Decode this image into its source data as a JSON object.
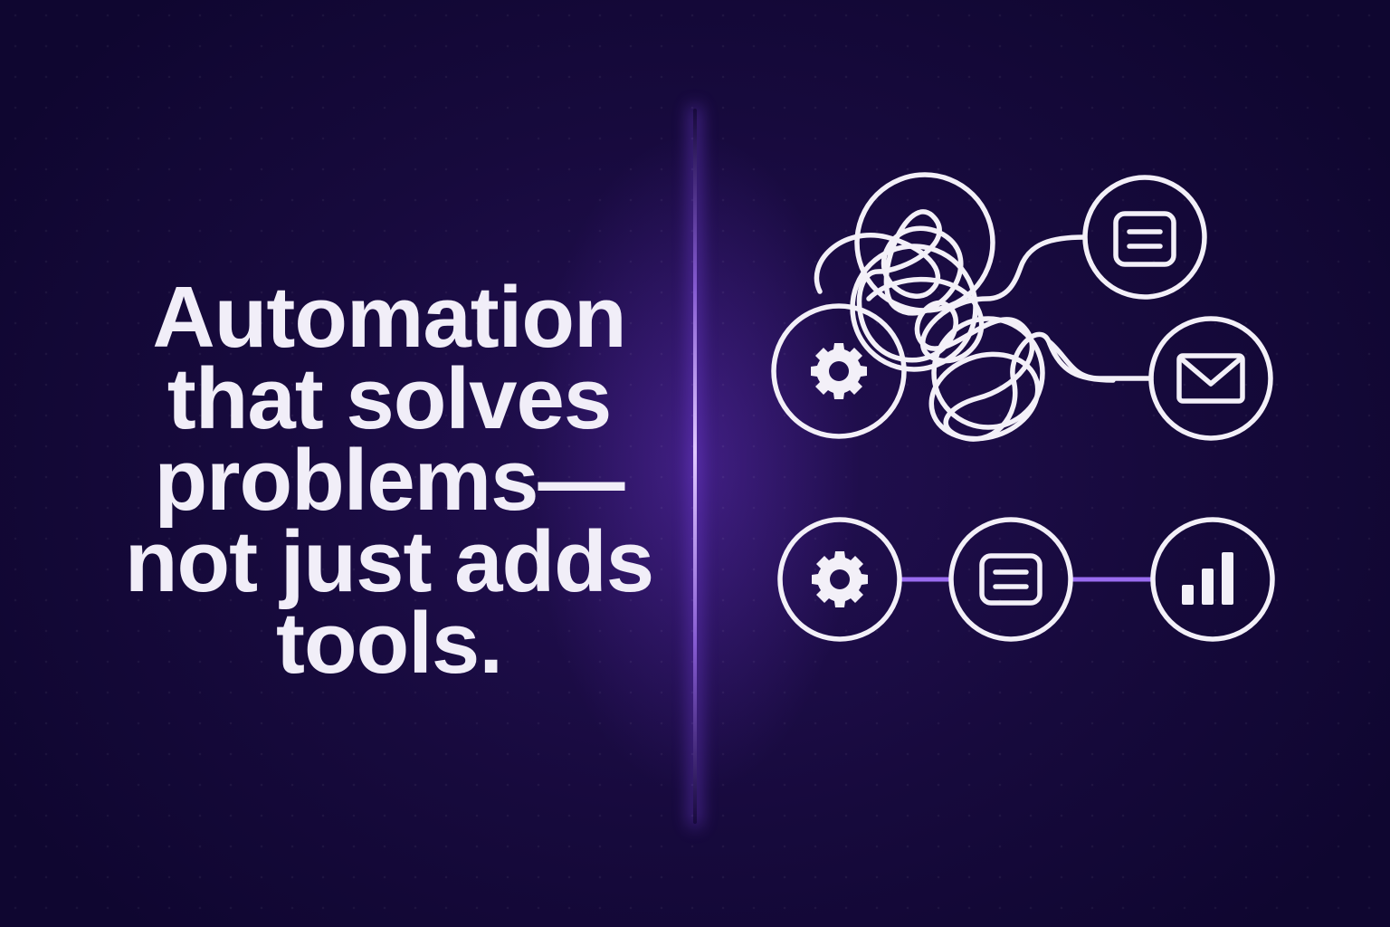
{
  "headline": {
    "lines": [
      "Automation",
      "that solves",
      "problems—",
      "not just adds",
      "tools."
    ]
  },
  "colors": {
    "background": "#170a3d",
    "text": "#f1eef8",
    "accent": "#9a6cf0",
    "stroke": "#f3f0f8"
  },
  "icons": {
    "chaos": [
      "gear-icon",
      "document-icon",
      "mail-icon"
    ],
    "flow": [
      "gear-icon",
      "document-icon",
      "bar-chart-icon"
    ]
  }
}
